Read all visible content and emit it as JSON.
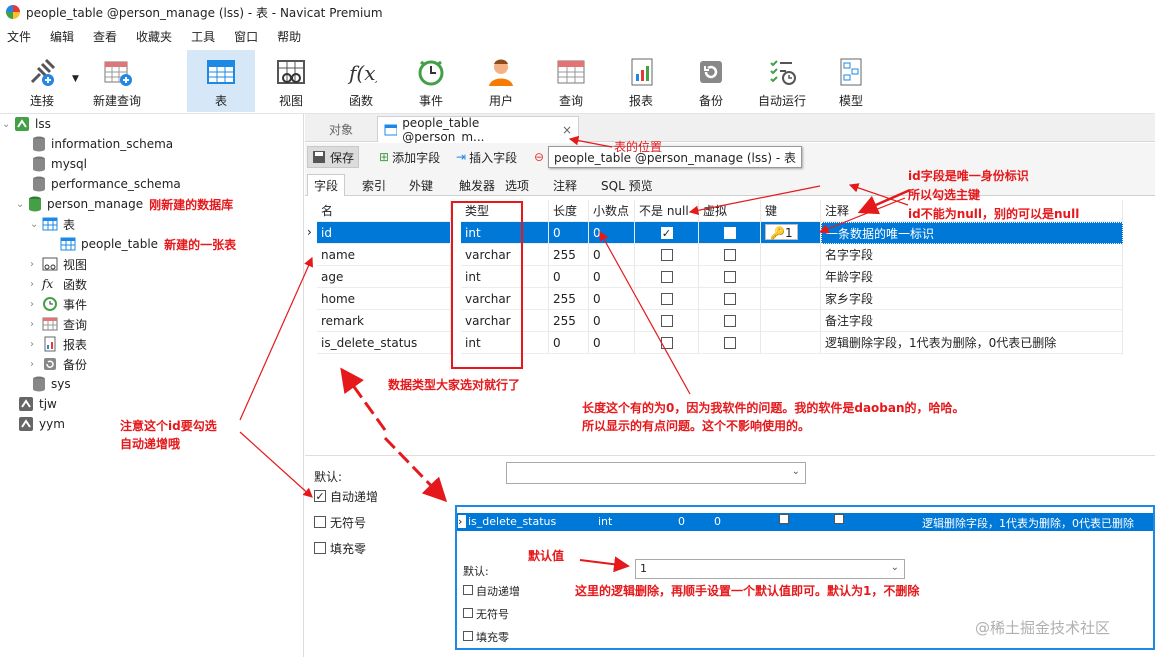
{
  "window": {
    "title": "people_table @person_manage (lss) - 表 - Navicat Premium"
  },
  "menu": [
    "文件",
    "编辑",
    "查看",
    "收藏夹",
    "工具",
    "窗口",
    "帮助"
  ],
  "toolbar": {
    "connect": "连接",
    "new_query": "新建查询",
    "table": "表",
    "view": "视图",
    "function": "函数",
    "event": "事件",
    "user": "用户",
    "query": "查询",
    "report": "报表",
    "backup": "备份",
    "automation": "自动运行",
    "model": "模型"
  },
  "sidebar": {
    "conn_lss": "lss",
    "db_information_schema": "information_schema",
    "db_mysql": "mysql",
    "db_performance_schema": "performance_schema",
    "db_person_manage": "person_manage",
    "annot_new_db": "刚新建的数据库",
    "node_table": "表",
    "table_people": "people_table",
    "annot_new_table": "新建的一张表",
    "node_view": "视图",
    "node_function": "函数",
    "node_event": "事件",
    "node_query": "查询",
    "node_report": "报表",
    "node_backup": "备份",
    "db_sys": "sys",
    "conn_tjw": "tjw",
    "conn_yym": "yym"
  },
  "tabs": {
    "objects": "对象",
    "active": "people_table @person_m...",
    "close": "×",
    "tooltip": "people_table @person_manage (lss) - 表"
  },
  "subtool": {
    "save": "保存",
    "add_field": "添加字段",
    "insert_field": "插入字段",
    "delete_field": "删"
  },
  "field_tabs": [
    "字段",
    "索引",
    "外键",
    "触发器",
    "选项",
    "注释",
    "SQL 预览"
  ],
  "grid": {
    "headers": {
      "name": "名",
      "type": "类型",
      "length": "长度",
      "decimals": "小数点",
      "not_null": "不是 null",
      "virtual": "虚拟",
      "key": "键",
      "comment": "注释"
    },
    "rows": [
      {
        "name": "id",
        "type": "int",
        "length": "0",
        "decimals": "0",
        "not_null": true,
        "virtual": false,
        "key": "1",
        "comment": "一条数据的唯一标识"
      },
      {
        "name": "name",
        "type": "varchar",
        "length": "255",
        "decimals": "0",
        "not_null": false,
        "virtual": false,
        "key": "",
        "comment": "名字字段"
      },
      {
        "name": "age",
        "type": "int",
        "length": "0",
        "decimals": "0",
        "not_null": false,
        "virtual": false,
        "key": "",
        "comment": "年龄字段"
      },
      {
        "name": "home",
        "type": "varchar",
        "length": "255",
        "decimals": "0",
        "not_null": false,
        "virtual": false,
        "key": "",
        "comment": "家乡字段"
      },
      {
        "name": "remark",
        "type": "varchar",
        "length": "255",
        "decimals": "0",
        "not_null": false,
        "virtual": false,
        "key": "",
        "comment": "备注字段"
      },
      {
        "name": "is_delete_status",
        "type": "int",
        "length": "0",
        "decimals": "0",
        "not_null": false,
        "virtual": false,
        "key": "",
        "comment": "逻辑删除字段，1代表为删除，0代表已删除"
      }
    ]
  },
  "bottom": {
    "default_label": "默认:",
    "auto_increment": "自动递增",
    "unsigned": "无符号",
    "zerofill": "填充零"
  },
  "inset": {
    "row": {
      "name": "is_delete_status",
      "type": "int",
      "length": "0",
      "decimals": "0",
      "comment": "逻辑删除字段，1代表为删除，0代表已删除"
    },
    "default_label": "默认:",
    "default_value": "1",
    "auto_increment": "自动递增",
    "unsigned": "无符号",
    "zerofill": "填充零"
  },
  "annotations": {
    "table_position": "表的位置",
    "pk_line1": "id字段是唯一身份标识",
    "pk_line2": "所以勾选主键",
    "pk_line3": "id不能为null，别的可以是null",
    "types": "数据类型大家选对就行了",
    "length_line1": "长度这个有的为0，因为我软件的问题。我的软件是daoban的，哈哈。",
    "length_line2": "所以显示的有点问题。这个不影响使用的。",
    "ai_line1": "注意这个id要勾选",
    "ai_line2": "自动递增哦",
    "default_value": "默认值",
    "default_desc": "这里的逻辑删除，再顺手设置一个默认值即可。默认为1，不删除"
  },
  "watermark": "@稀土掘金技术社区",
  "colors": {
    "accent": "#0078d7",
    "annotation": "#e5191c",
    "active_tool": "#d6e7f7"
  }
}
